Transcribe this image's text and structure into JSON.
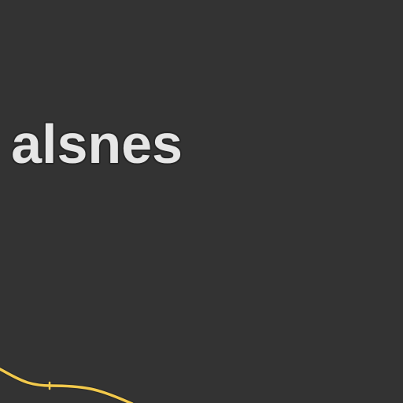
{
  "map": {
    "background_color": "#333333",
    "place_label": {
      "text": "alsnes",
      "color": "#e6e6e6",
      "halo_color": "#262626"
    },
    "roads": [
      {
        "name": "",
        "color": "#f2c94c",
        "casing_color": "#2a2a2a"
      }
    ]
  }
}
